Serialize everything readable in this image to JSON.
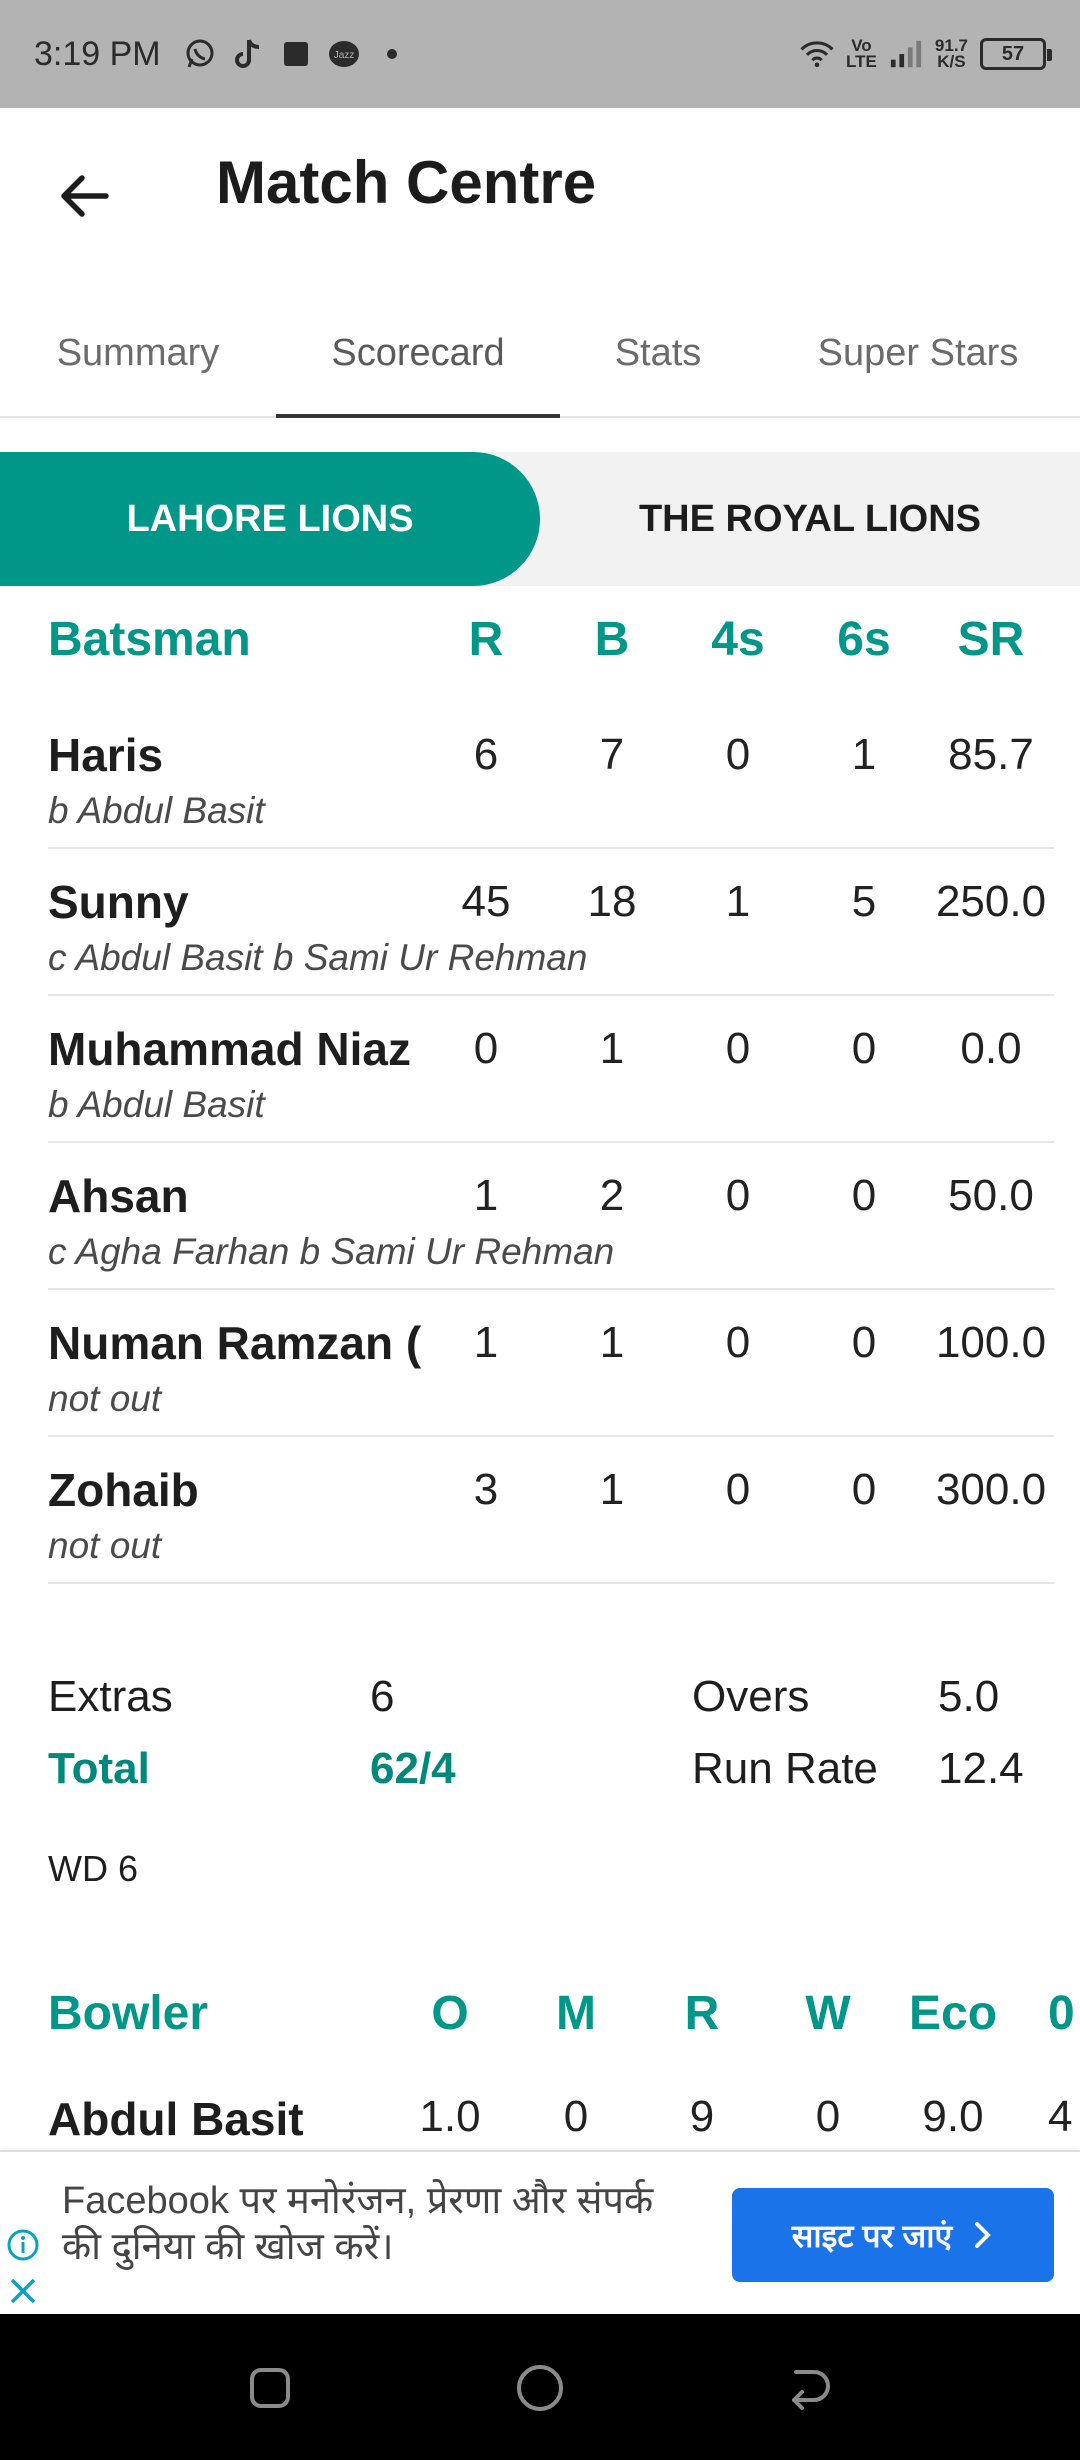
{
  "status_bar": {
    "time": "3:19 PM",
    "network_label_top": "Vo",
    "network_label_bottom": "LTE",
    "speed_value": "91.7",
    "speed_unit": "K/S",
    "battery": "57",
    "icons": [
      "whatsapp-icon",
      "tiktok-icon",
      "square-icon",
      "jazz-icon",
      "dot-icon",
      "wifi-icon",
      "signal-icon"
    ]
  },
  "header": {
    "title": "Match Centre"
  },
  "tabs": [
    {
      "label": "Summary",
      "active": false
    },
    {
      "label": "Scorecard",
      "active": true
    },
    {
      "label": "Stats",
      "active": false
    },
    {
      "label": "Super Stars",
      "active": false
    }
  ],
  "teams": {
    "active": "LAHORE LIONS",
    "inactive": "THE ROYAL LIONS"
  },
  "batting": {
    "headers": {
      "name": "Batsman",
      "r": "R",
      "b": "B",
      "fours": "4s",
      "sixes": "6s",
      "sr": "SR"
    },
    "rows": [
      {
        "name": "Haris",
        "dismissal": "b Abdul Basit",
        "r": "6",
        "b": "7",
        "fours": "0",
        "sixes": "1",
        "sr": "85.7"
      },
      {
        "name": "Sunny",
        "dismissal": "c Abdul Basit b Sami Ur Rehman",
        "r": "45",
        "b": "18",
        "fours": "1",
        "sixes": "5",
        "sr": "250.0"
      },
      {
        "name": "Muhammad Niaz",
        "dismissal": "b Abdul Basit",
        "r": "0",
        "b": "1",
        "fours": "0",
        "sixes": "0",
        "sr": "0.0"
      },
      {
        "name": "Ahsan",
        "dismissal": "c Agha Farhan b Sami Ur Rehman",
        "r": "1",
        "b": "2",
        "fours": "0",
        "sixes": "0",
        "sr": "50.0"
      },
      {
        "name": "Numan Ramzan (",
        "dismissal": "not out",
        "r": "1",
        "b": "1",
        "fours": "0",
        "sixes": "0",
        "sr": "100.0"
      },
      {
        "name": "Zohaib",
        "dismissal": "not out",
        "r": "3",
        "b": "1",
        "fours": "0",
        "sixes": "0",
        "sr": "300.0"
      }
    ]
  },
  "summary": {
    "extras_label": "Extras",
    "extras_value": "6",
    "total_label": "Total",
    "total_value": "62/4",
    "overs_label": "Overs",
    "overs_value": "5.0",
    "run_rate_label": "Run Rate",
    "run_rate_value": "12.4",
    "wide_note": "WD 6"
  },
  "bowling": {
    "headers": {
      "name": "Bowler",
      "o": "O",
      "m": "M",
      "r": "R",
      "w": "W",
      "eco": "Eco",
      "extra": "0"
    },
    "rows": [
      {
        "name": "Abdul Basit",
        "o": "1.0",
        "m": "0",
        "r": "9",
        "w": "0",
        "eco": "9.0",
        "extra": "4"
      }
    ]
  },
  "ad": {
    "text": "Facebook पर मनोरंजन, प्रेरणा और संपर्क की दुनिया की खोज करें।",
    "cta": "साइट पर जाएं"
  },
  "colors": {
    "accent": "#009688",
    "status_bar_bg": "#b3b3b3",
    "ad_button": "#1a73e8",
    "nav_bar": "#000000"
  }
}
